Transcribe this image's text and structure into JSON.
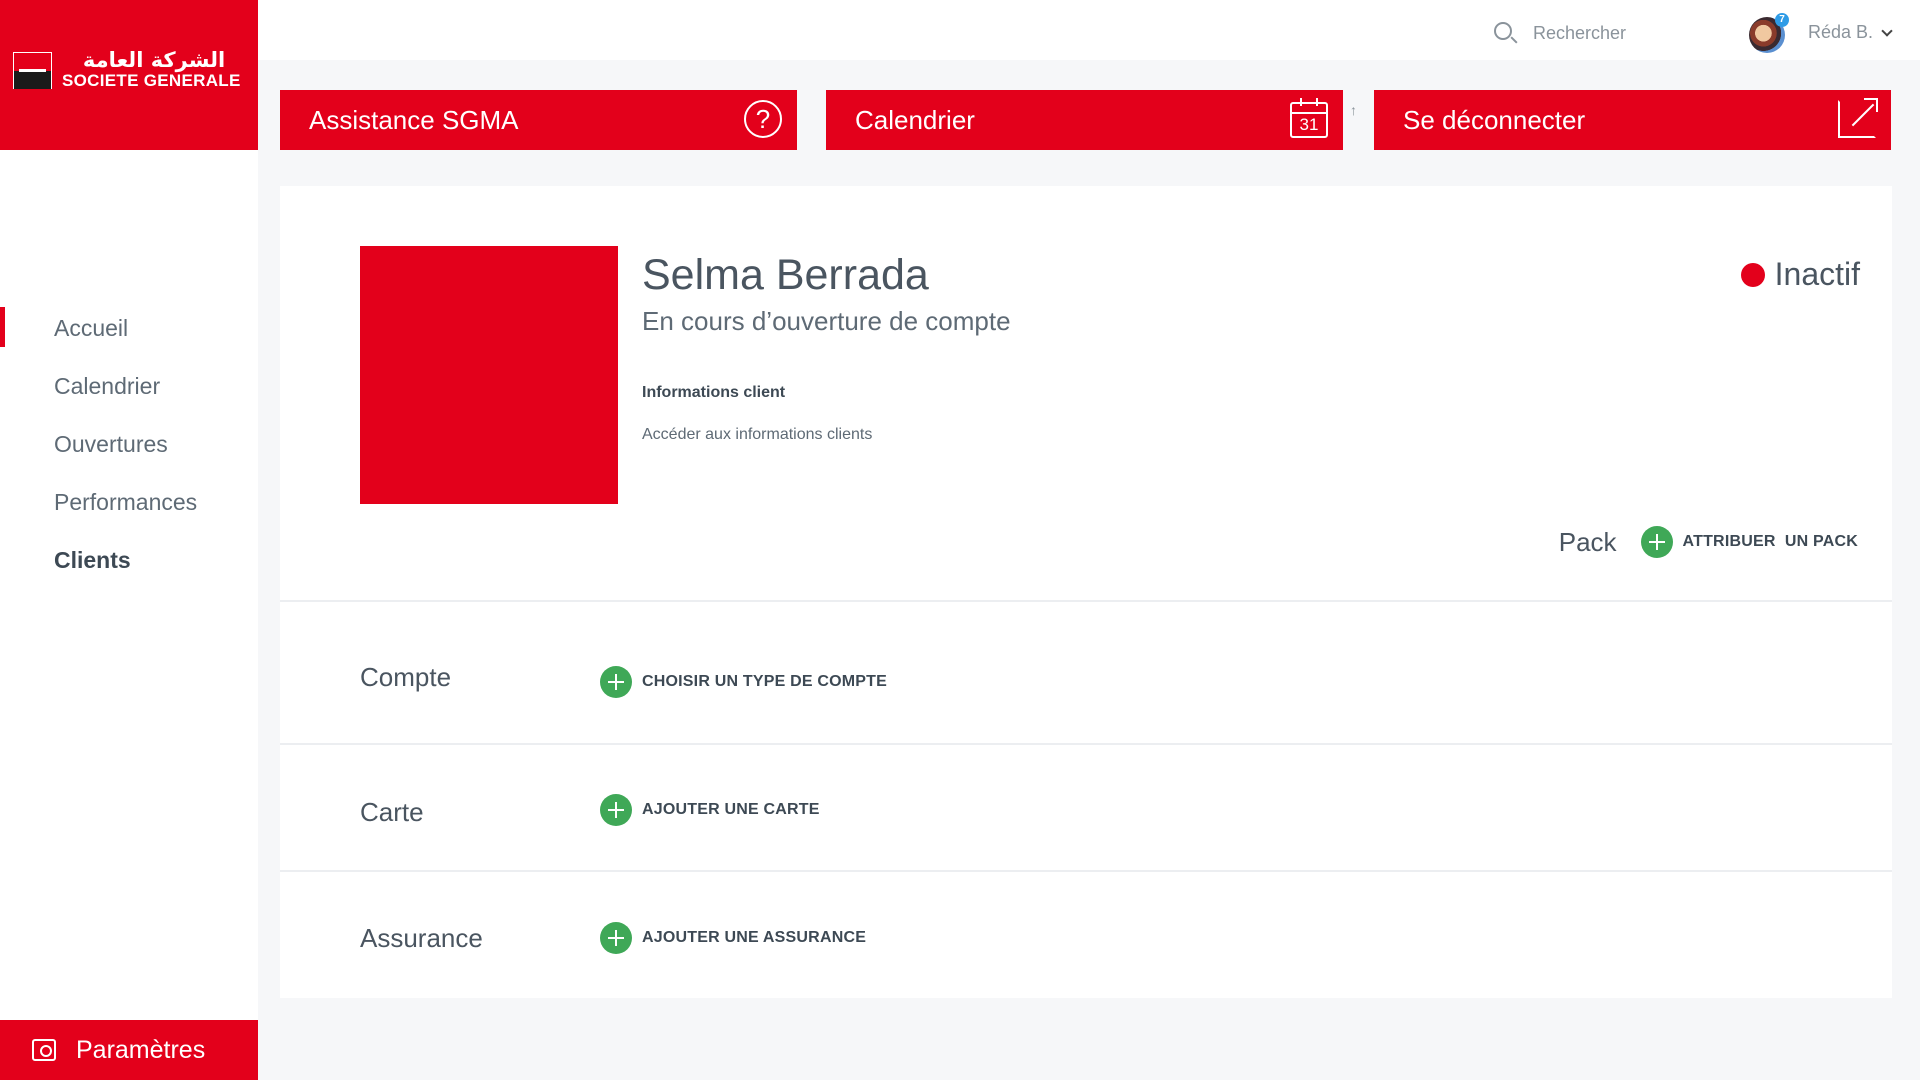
{
  "brand": {
    "arabic": "الشركة العامة",
    "latin": "SOCIETE GENERALE",
    "color": "#e3001b"
  },
  "nav": {
    "items": [
      {
        "label": "Accueil"
      },
      {
        "label": "Calendrier"
      },
      {
        "label": "Ouvertures"
      },
      {
        "label": "Performances"
      },
      {
        "label": "Clients"
      }
    ],
    "active": "Clients"
  },
  "settings": {
    "label": "Paramètres",
    "icon": "settings-icon"
  },
  "topbar": {
    "search_placeholder": "Rechercher",
    "user_name": "Réda B.",
    "notification_count": "7"
  },
  "actions": {
    "assistance": {
      "label": "Assistance SGMA",
      "icon": "help-icon"
    },
    "calendar": {
      "label": "Calendrier",
      "icon": "calendar-icon",
      "day": "31"
    },
    "logout": {
      "label": "Se déconnecter",
      "icon": "external-link-icon"
    },
    "arrow": "↑"
  },
  "client": {
    "name": "Selma Berrada",
    "status": "En cours d’ouverture de compte",
    "info_title": "Informations client",
    "info_link": "Accéder aux informations clients",
    "state": "Inactif",
    "state_color": "#e3001b"
  },
  "pack": {
    "label": "Pack",
    "action": "ATTRIBUER  UN PACK"
  },
  "sections": [
    {
      "label": "Compte",
      "action": "CHOISIR UN TYPE DE COMPTE"
    },
    {
      "label": "Carte",
      "action": "AJOUTER UNE CARTE"
    },
    {
      "label": "Assurance",
      "action": "AJOUTER UNE ASSURANCE"
    }
  ],
  "colors": {
    "accent": "#e3001b",
    "add": "#3fa857",
    "text": "#4a5560"
  }
}
